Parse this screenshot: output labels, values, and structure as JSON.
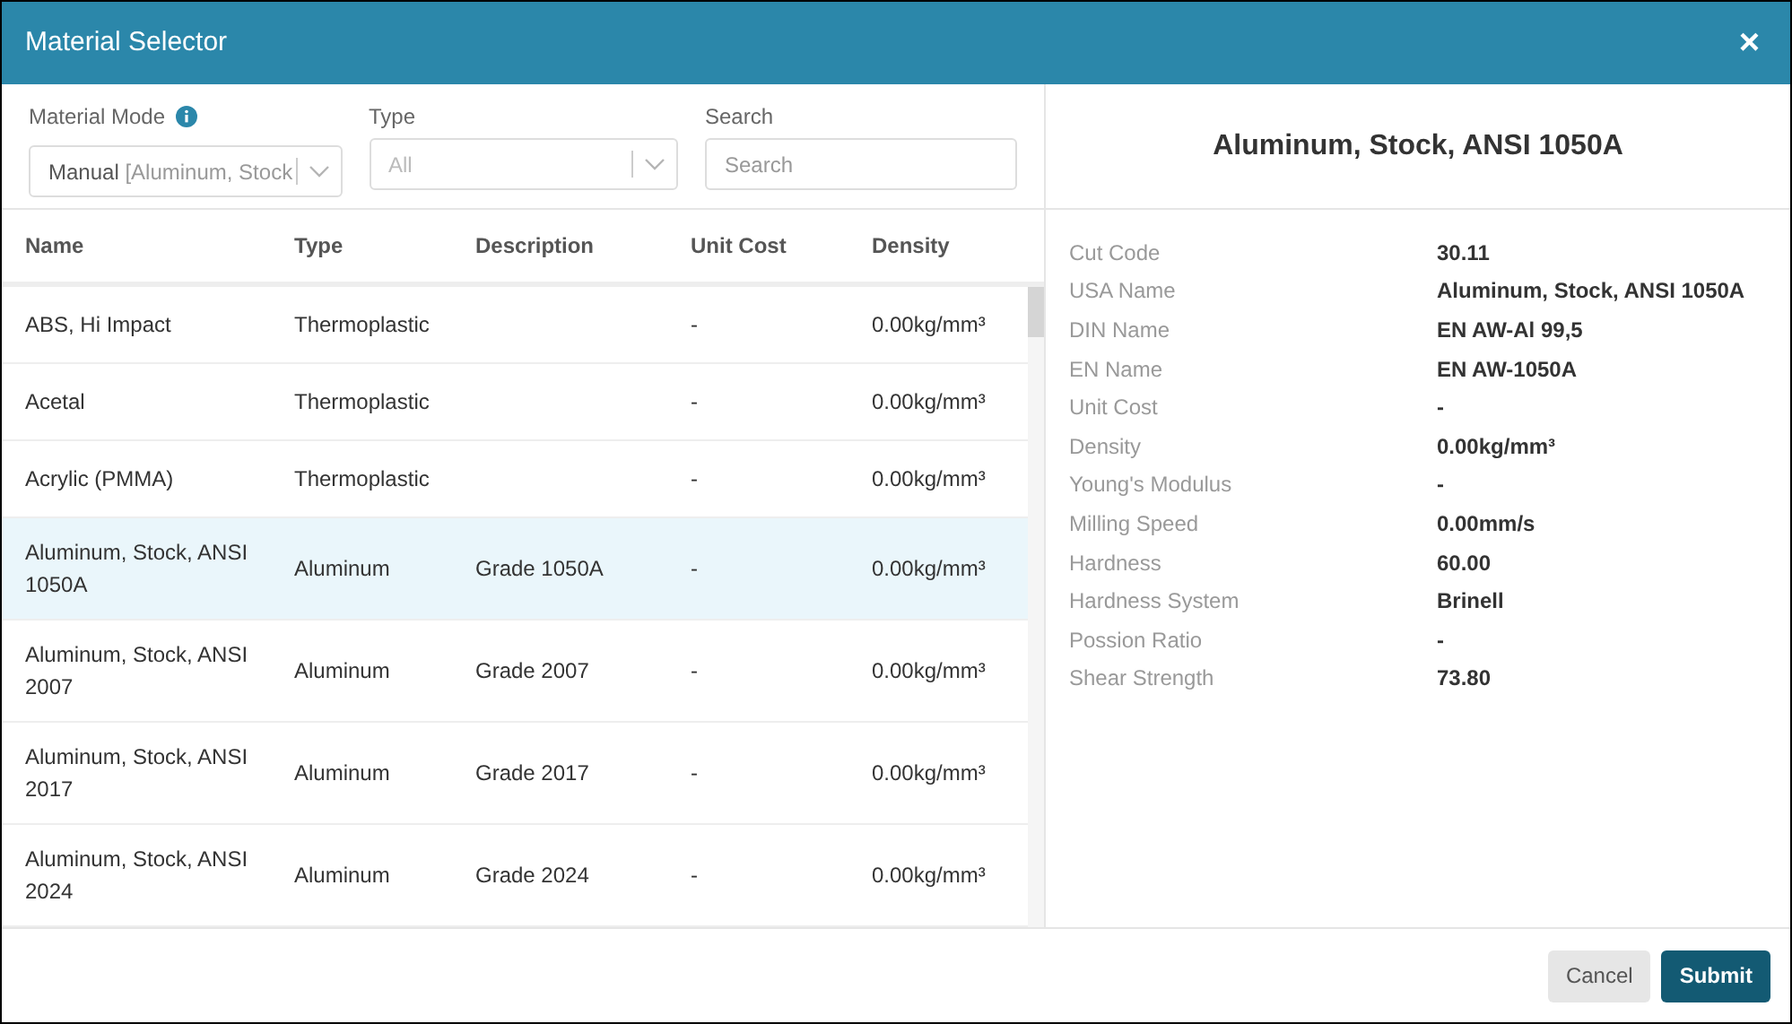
{
  "window": {
    "title": "Material Selector",
    "close": "×"
  },
  "filters": {
    "mode": {
      "label": "Material Mode",
      "value": "Manual",
      "value_detail": "[Aluminum, Stock"
    },
    "type": {
      "label": "Type",
      "value": "All"
    },
    "search": {
      "label": "Search",
      "placeholder": "Search"
    }
  },
  "table": {
    "columns": [
      "Name",
      "Type",
      "Description",
      "Unit Cost",
      "Density"
    ],
    "rows": [
      {
        "cells": [
          "ABS, Hi Impact",
          "Thermoplastic",
          "",
          "-",
          "0.00kg/mm³"
        ],
        "selected": false
      },
      {
        "cells": [
          "Acetal",
          "Thermoplastic",
          "",
          "-",
          "0.00kg/mm³"
        ],
        "selected": false
      },
      {
        "cells": [
          "Acrylic (PMMA)",
          "Thermoplastic",
          "",
          "-",
          "0.00kg/mm³"
        ],
        "selected": false
      },
      {
        "cells": [
          "Aluminum, Stock, ANSI 1050A",
          "Aluminum",
          "Grade 1050A",
          "-",
          "0.00kg/mm³"
        ],
        "selected": true
      },
      {
        "cells": [
          "Aluminum, Stock, ANSI 2007",
          "Aluminum",
          "Grade 2007",
          "-",
          "0.00kg/mm³"
        ],
        "selected": false
      },
      {
        "cells": [
          "Aluminum, Stock, ANSI 2017",
          "Aluminum",
          "Grade 2017",
          "-",
          "0.00kg/mm³"
        ],
        "selected": false
      },
      {
        "cells": [
          "Aluminum, Stock, ANSI 2024",
          "Aluminum",
          "Grade 2024",
          "-",
          "0.00kg/mm³"
        ],
        "selected": false
      }
    ]
  },
  "details": {
    "title": "Aluminum, Stock, ANSI 1050A",
    "properties": [
      {
        "label": "Cut Code",
        "value": "30.11"
      },
      {
        "label": "USA Name",
        "value": "Aluminum, Stock, ANSI 1050A"
      },
      {
        "label": "DIN Name",
        "value": "EN AW-Al 99,5"
      },
      {
        "label": "EN Name",
        "value": "EN AW-1050A"
      },
      {
        "label": "Unit Cost",
        "value": "-"
      },
      {
        "label": "Density",
        "value": "0.00kg/mm³"
      },
      {
        "label": "Young's Modulus",
        "value": "-"
      },
      {
        "label": "Milling Speed",
        "value": "0.00mm/s"
      },
      {
        "label": "Hardness",
        "value": "60.00"
      },
      {
        "label": "Hardness System",
        "value": "Brinell"
      },
      {
        "label": "Possion Ratio",
        "value": "-"
      },
      {
        "label": "Shear Strength",
        "value": "73.80"
      }
    ]
  },
  "buttons": [
    {
      "label": "Cancel",
      "kind": "secondary"
    },
    {
      "label": "Submit",
      "kind": "primary"
    }
  ]
}
